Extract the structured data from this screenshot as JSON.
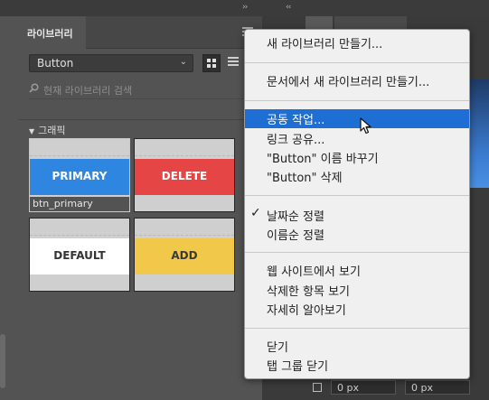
{
  "libraries_panel": {
    "tab_label": "라이브러리",
    "library_select": "Button",
    "search_placeholder": "현재 라이브러리 검색",
    "group_label": "그래픽",
    "tiles": [
      {
        "face_label": "PRIMARY",
        "face_color": "#2f86e0",
        "text_color": "#ffffff",
        "caption": "btn_primary"
      },
      {
        "face_label": "DELETE",
        "face_color": "#e54545",
        "text_color": "#ffffff",
        "caption": ""
      },
      {
        "face_label": "DEFAULT",
        "face_color": "#ffffff",
        "text_color": "#333333",
        "caption": ""
      },
      {
        "face_label": "ADD",
        "face_color": "#f2c84b",
        "text_color": "#3a3a3a",
        "caption": ""
      }
    ]
  },
  "right_panel": {
    "fields": [
      "0 px",
      "0 px"
    ]
  },
  "context_menu": {
    "items": [
      "새 라이브러리 만들기...",
      "문서에서 새 라이브러리 만들기...",
      "공동 작업...",
      "링크 공유...",
      "\"Button\" 이름 바꾸기",
      "\"Button\" 삭제",
      "날짜순 정렬",
      "이름순 정렬",
      "웹 사이트에서 보기",
      "삭제한 항목 보기",
      "자세히 알아보기",
      "닫기",
      "탭 그룹 닫기"
    ],
    "highlighted_index": 2,
    "checked_index": 6
  },
  "colors": {
    "accent": "#1f6ed4"
  }
}
